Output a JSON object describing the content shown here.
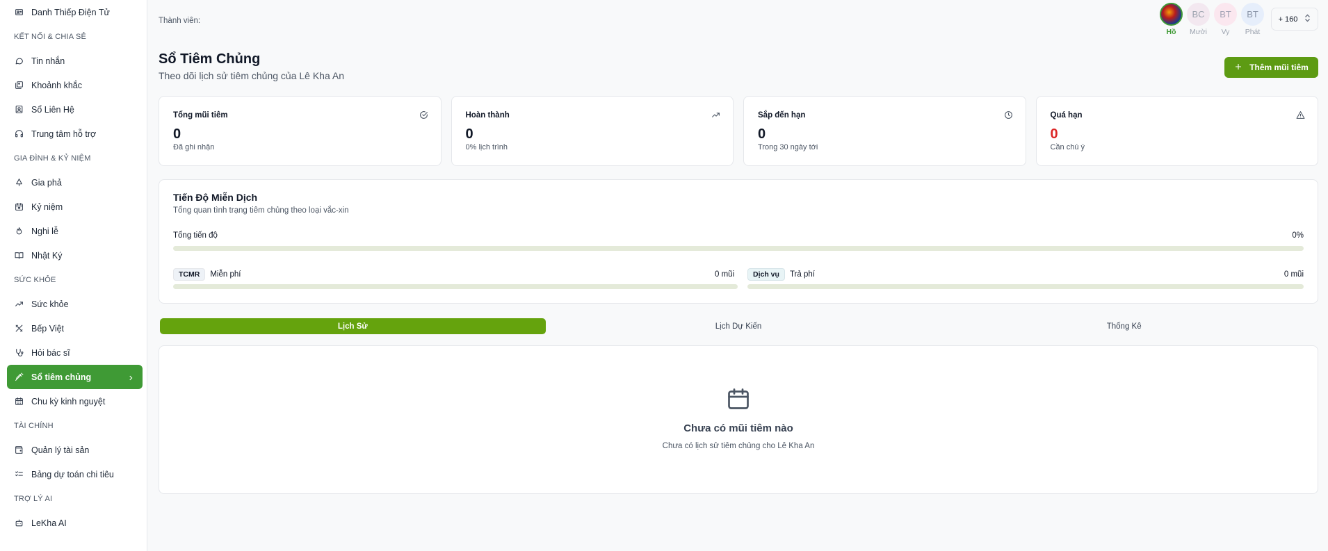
{
  "sidebar": {
    "items": [
      {
        "type": "item",
        "label": "Danh Thiếp Điện Tử",
        "icon": "id-card-icon"
      },
      {
        "type": "section",
        "label": "KẾT NỐI & CHIA SẺ"
      },
      {
        "type": "item",
        "label": "Tin nhắn",
        "icon": "message-icon"
      },
      {
        "type": "item",
        "label": "Khoảnh khắc",
        "icon": "images-icon"
      },
      {
        "type": "item",
        "label": "Sổ Liên Hệ",
        "icon": "contact-book-icon"
      },
      {
        "type": "item",
        "label": "Trung tâm hỗ trợ",
        "icon": "headphones-icon"
      },
      {
        "type": "section",
        "label": "GIA ĐÌNH & KỶ NIỆM"
      },
      {
        "type": "item",
        "label": "Gia phả",
        "icon": "tree-icon"
      },
      {
        "type": "item",
        "label": "Kỷ niệm",
        "icon": "calendar-heart-icon"
      },
      {
        "type": "item",
        "label": "Nghi lễ",
        "icon": "flame-icon"
      },
      {
        "type": "item",
        "label": "Nhật Ký",
        "icon": "book-open-icon"
      },
      {
        "type": "section",
        "label": "SỨC KHỎE"
      },
      {
        "type": "item",
        "label": "Sức khỏe",
        "icon": "trending-up-icon"
      },
      {
        "type": "item",
        "label": "Bếp Việt",
        "icon": "utensils-icon"
      },
      {
        "type": "item",
        "label": "Hỏi bác sĩ",
        "icon": "stethoscope-icon"
      },
      {
        "type": "item",
        "label": "Sổ tiêm chủng",
        "icon": "syringe-icon",
        "active": true
      },
      {
        "type": "item",
        "label": "Chu kỳ kinh nguyệt",
        "icon": "calendar-icon"
      },
      {
        "type": "section",
        "label": "TÀI CHÍNH"
      },
      {
        "type": "item",
        "label": "Quản lý tài sản",
        "icon": "wallet-icon"
      },
      {
        "type": "item",
        "label": "Bảng dự toán chi tiêu",
        "icon": "list-checks-icon"
      },
      {
        "type": "section",
        "label": "TRỢ LÝ AI"
      },
      {
        "type": "item",
        "label": "LeKha AI",
        "icon": "bot-icon"
      }
    ]
  },
  "header": {
    "members_label": "Thành viên:",
    "members": [
      {
        "initials": "",
        "name": "Hồ",
        "selected": true
      },
      {
        "initials": "BC",
        "name": "Mười"
      },
      {
        "initials": "BT",
        "name": "Vy"
      },
      {
        "initials": "BT",
        "name": "Phát"
      }
    ],
    "more_label": "+ 160"
  },
  "page": {
    "title": "Sổ Tiêm Chủng",
    "subtitle": "Theo dõi lịch sử tiêm chủng của Lê Kha An",
    "add_button": "Thêm mũi tiêm"
  },
  "stats": [
    {
      "label": "Tổng mũi tiêm",
      "value": "0",
      "desc": "Đã ghi nhận",
      "icon": "check-circle-icon"
    },
    {
      "label": "Hoàn thành",
      "value": "0",
      "desc": "0% lịch trình",
      "icon": "trending-up-icon"
    },
    {
      "label": "Sắp đến hạn",
      "value": "0",
      "desc": "Trong 30 ngày tới",
      "icon": "clock-icon"
    },
    {
      "label": "Quá hạn",
      "value": "0",
      "desc": "Cần chú ý",
      "icon": "alert-triangle-icon",
      "accent": "#dc2626"
    }
  ],
  "progress": {
    "title": "Tiến Độ Miễn Dịch",
    "subtitle": "Tổng quan tình trạng tiêm chủng theo loại vắc-xin",
    "total_label": "Tổng tiến độ",
    "total_pct": "0%",
    "total_fraction": 0,
    "groups": [
      {
        "badge": "TCMR",
        "label": "Miễn phí",
        "count": "0 mũi",
        "fraction": 0
      },
      {
        "badge": "Dịch vụ",
        "label": "Trả phí",
        "count": "0 mũi",
        "fraction": 0
      }
    ]
  },
  "tabs": [
    {
      "label": "Lịch Sử",
      "active": true
    },
    {
      "label": "Lịch Dự Kiến"
    },
    {
      "label": "Thống Kê"
    }
  ],
  "empty": {
    "title": "Chưa có mũi tiêm nào",
    "subtitle": "Chưa có lịch sử tiêm chủng cho Lê Kha An"
  },
  "colors": {
    "accent": "#3f9a35",
    "button": "#5d9b13",
    "danger": "#dc2626"
  }
}
